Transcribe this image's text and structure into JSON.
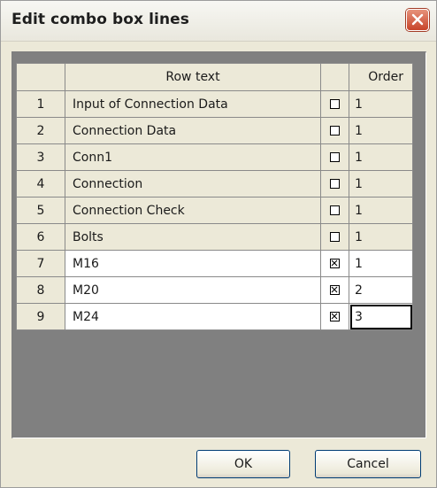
{
  "window": {
    "title": "Edit combo box lines"
  },
  "grid": {
    "headers": {
      "number": "",
      "row_text": "Row text",
      "checked": "",
      "order": "Order"
    },
    "rows": [
      {
        "num": "1",
        "text": "Input of Connection Data",
        "checked": false,
        "order": "1"
      },
      {
        "num": "2",
        "text": "Connection Data",
        "checked": false,
        "order": "1"
      },
      {
        "num": "3",
        "text": "Conn1",
        "checked": false,
        "order": "1"
      },
      {
        "num": "4",
        "text": "Connection",
        "checked": false,
        "order": "1"
      },
      {
        "num": "5",
        "text": "Connection Check",
        "checked": false,
        "order": "1"
      },
      {
        "num": "6",
        "text": "Bolts",
        "checked": false,
        "order": "1"
      },
      {
        "num": "7",
        "text": "M16",
        "checked": true,
        "order": "1"
      },
      {
        "num": "8",
        "text": "M20",
        "checked": true,
        "order": "2"
      },
      {
        "num": "9",
        "text": "M24",
        "checked": true,
        "order": "3"
      }
    ]
  },
  "buttons": {
    "ok": "OK",
    "cancel": "Cancel"
  },
  "colors": {
    "dialog_bg": "#ece9d8",
    "grid_empty_bg": "#808080",
    "close_button": "#c8442a"
  }
}
